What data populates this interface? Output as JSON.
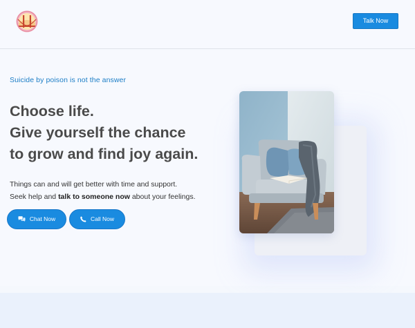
{
  "header": {
    "logo_icon": "golden-gate-bridge-badge-icon",
    "talk_label": "Talk Now"
  },
  "hero": {
    "eyebrow": "Suicide by poison is not the answer",
    "headline_strong": "Choose life.",
    "headline_line1": "Give yourself the chance",
    "headline_line2": "to grow and find joy again.",
    "support_line1": "Things can and will get better with time and support.",
    "support_pre": "Seek help and ",
    "support_bold": "talk to someone now",
    "support_post": " about your feelings.",
    "chat_label": "Chat Now",
    "call_label": "Call Now",
    "chat_icon": "chat-bubbles-icon",
    "call_icon": "phone-icon",
    "image_subject": "armchair-with-pillows-and-blanket"
  },
  "colors": {
    "accent": "#1a8be0",
    "eyebrow": "#1b7dc6",
    "background": "#f7f9fe",
    "footer_band": "#eaf1fc"
  }
}
